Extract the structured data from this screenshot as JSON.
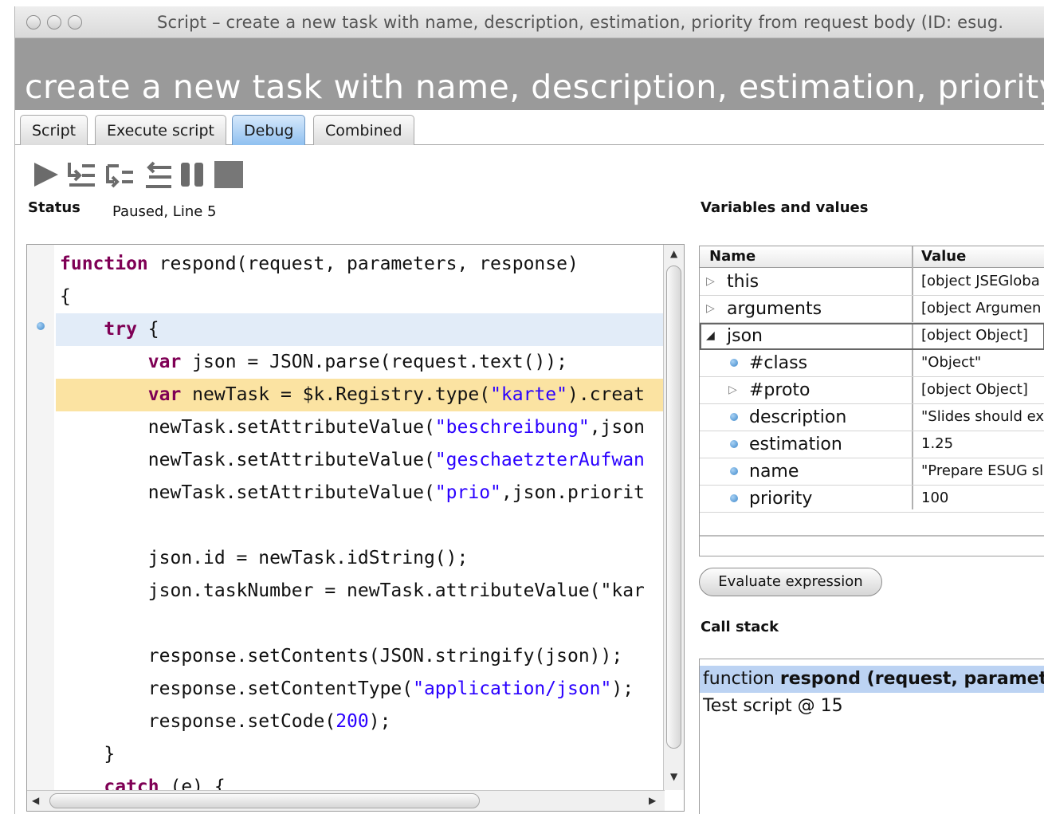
{
  "window": {
    "title": "Script – create a new task with name, description, estimation, priority from request body (ID: esug."
  },
  "header": {
    "title": "create a new task with name, description, estimation, priority"
  },
  "tabs": [
    {
      "label": "Script"
    },
    {
      "label": "Execute script"
    },
    {
      "label": "Debug",
      "active": true
    },
    {
      "label": "Combined"
    }
  ],
  "toolbar": {
    "buttons": [
      "play-icon",
      "step-over-icon",
      "step-into-icon",
      "step-out-icon",
      "pause-icon",
      "stop-icon"
    ]
  },
  "status": {
    "label": "Status",
    "value": "Paused, Line 5"
  },
  "variables": {
    "title": "Variables and values",
    "col_name": "Name",
    "col_value": "Value",
    "rows": [
      {
        "name": "this",
        "value": "[object JSEGloba",
        "marker": "collapsed"
      },
      {
        "name": "arguments",
        "value": "[object Argumen",
        "marker": "collapsed"
      },
      {
        "name": "json",
        "value": "[object Object]",
        "marker": "expanded"
      },
      {
        "name": "#class",
        "value": "\"Object\"",
        "marker": "leaf"
      },
      {
        "name": "#proto",
        "value": "[object Object]",
        "marker": "collapsed"
      },
      {
        "name": "description",
        "value": "\"Slides should ex",
        "marker": "leaf"
      },
      {
        "name": "estimation",
        "value": "1.25",
        "marker": "leaf"
      },
      {
        "name": "name",
        "value": "\"Prepare ESUG sl",
        "marker": "leaf"
      },
      {
        "name": "priority",
        "value": "100",
        "marker": "leaf"
      }
    ]
  },
  "eval_button": "Evaluate expression",
  "callstack": {
    "title": "Call stack",
    "items": [
      {
        "prefix": "function ",
        "bold": "respond (request, paramete"
      },
      {
        "prefix": "Test script @ 15",
        "bold": ""
      }
    ]
  },
  "code": {
    "l1": {
      "kw": "function",
      "rest": " respond(request, parameters, response)"
    },
    "l2": "{",
    "l3": {
      "indent": "    ",
      "kw": "try",
      "rest": " {"
    },
    "l4": {
      "indent": "        ",
      "kw": "var",
      "rest": " json = JSON.parse(request.text());"
    },
    "l5": {
      "indent": "        ",
      "kw": "var",
      "rest": " newTask = $k.Registry.type(",
      "str": "\"karte\"",
      "tail": ").creat"
    },
    "l6": {
      "pre": "        newTask.setAttributeValue(",
      "str": "\"beschreibung\"",
      "tail": ",json"
    },
    "l7": {
      "pre": "        newTask.setAttributeValue(",
      "str": "\"geschaetzterAufwan",
      "tail": ""
    },
    "l8": {
      "pre": "        newTask.setAttributeValue(",
      "str": "\"prio\"",
      "tail": ",json.priorit"
    },
    "l10": "        json.id = newTask.idString();",
    "l11": "        json.taskNumber = newTask.attributeValue(\"kar",
    "l13": "        response.setContents(JSON.stringify(json));",
    "l14": {
      "pre": "        response.setContentType(",
      "str": "\"application/json\"",
      "tail": ");"
    },
    "l15": {
      "pre": "        response.setCode(",
      "num": "200",
      "tail": ");"
    },
    "l16": "    }",
    "l17": {
      "indent": "    ",
      "kw": "catch",
      "rest": " (e) {"
    }
  }
}
